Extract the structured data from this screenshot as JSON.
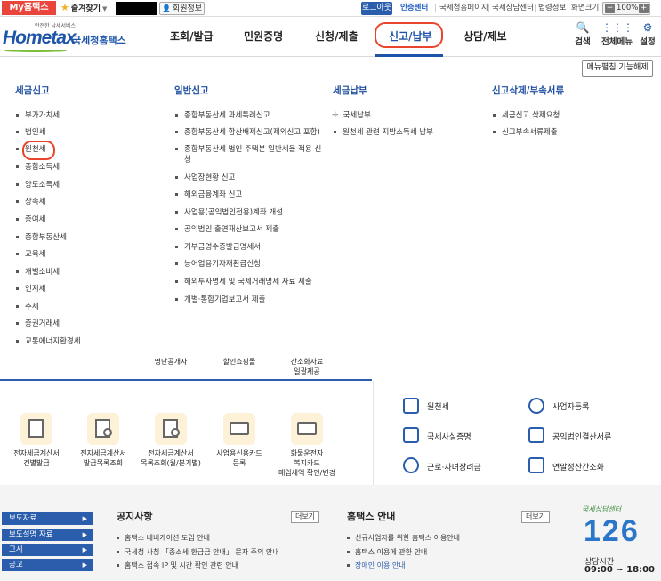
{
  "topbar": {
    "my_hometax": "My홈택스",
    "favorites": "즐겨찾기",
    "my_info": "회원정보",
    "logout": "로그아웃",
    "links": [
      "인증센터",
      "국세청홈페이지",
      "국세상담센터",
      "법령정보",
      "화면크기"
    ],
    "zoom": "100%"
  },
  "header": {
    "logo_small": "안전한 납세서비스",
    "logo_brand": "Hometax",
    "logo_sub": "국세청홈택스",
    "nav": [
      "조회/발급",
      "민원증명",
      "신청/제출",
      "신고/납부",
      "상담/제보"
    ],
    "active_nav": "신고/납부",
    "tools": [
      "검색",
      "전체메뉴",
      "설정"
    ]
  },
  "megamenu": {
    "menu_fix": "메뉴펼침 기능해제",
    "columns": [
      {
        "heading": "세금신고",
        "items": [
          "부가가치세",
          "법인세",
          "원천세",
          "종합소득세",
          "양도소득세",
          "상속세",
          "증여세",
          "종합부동산세",
          "교육세",
          "개별소비세",
          "인지세",
          "주세",
          "증권거래세",
          "교통에너지환경세"
        ]
      },
      {
        "heading": "일반신고",
        "items": [
          "종합부동산세 과세특례신고",
          "종합부동산세 합산배제신고(제외신고 포함)",
          "종합부동산세 법인 주택분 일반세율 적용 신",
          "청",
          "사업장현황 신고",
          "해외금융계좌 신고",
          "사업용(공익법인전용)계좌 개설",
          "공익법인 출연재산보고서 제출",
          "기부금영수증발급명세서",
          "농어업용기자재환급신청",
          "해외투자명세 및 국제거래명세 자료 제출",
          "개별·통합기업보고서 제출"
        ]
      },
      {
        "heading": "세금납부",
        "items": [
          "국세납부",
          "원천세 관련 지방소득세 납부"
        ]
      },
      {
        "heading": "신고삭제/부속서류",
        "items": [
          "세금신고 삭제요청",
          "신고부속서류제출"
        ]
      }
    ]
  },
  "underlying": {
    "partial_top": [
      "명단공개자",
      "할인쇼핑몰",
      "간소화자료",
      "일괄제공"
    ],
    "quick_icons": [
      {
        "label1": "전자세금계산서",
        "label2": "건별발급"
      },
      {
        "label1": "전자세금계산서",
        "label2": "발급목록조회"
      },
      {
        "label1": "전자세금계산서",
        "label2": "목록조회(월/분기별)"
      },
      {
        "label1": "사업용신용카드",
        "label2": "등록"
      },
      {
        "label1": "화물운전자",
        "label2": "복지카드",
        "label3": "매입세액 확인/변경"
      }
    ],
    "right_links": [
      "원천세",
      "사업자등록",
      "국세사실증명",
      "공익법인결산서류",
      "근로·자녀장려금",
      "연말정산간소화"
    ]
  },
  "footer": {
    "side_buttons": [
      "보도자료",
      "보도설명 자료",
      "고시",
      "공고"
    ],
    "notice_title": "공지사항",
    "notice_more": "더보기",
    "notices": [
      "홈택스 내비게이션 도입 안내",
      "국세청 사칭 「종소세 환급금 안내」 문자 주의 안내",
      "홈택스 접속 IP 및 시간 확인 관련 안내"
    ],
    "guide_title": "홈택스 안내",
    "guide_more": "더보기",
    "guides": [
      "신규사업자를 위한 홈택스 이용안내",
      "홈택스 이용에 관한 안내",
      "장애인 이용 안내"
    ],
    "cc_script": "국세상담센터",
    "cc_number": "126",
    "cc_hours_label": "상담시간",
    "cc_hours": "09:00 ~ 18:00"
  }
}
